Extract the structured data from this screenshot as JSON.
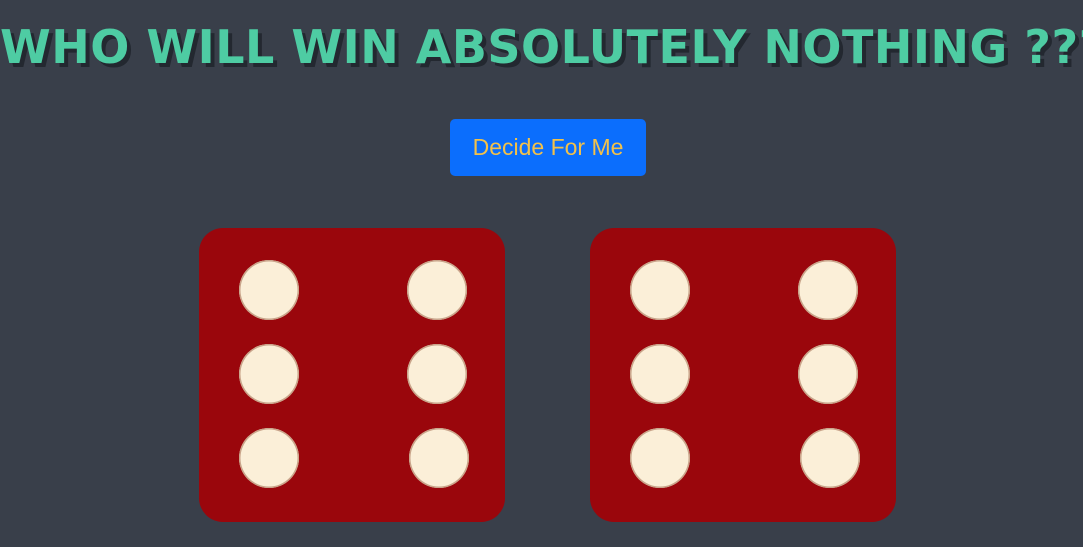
{
  "header": {
    "title": "WHO WILL WIN ABSOLUTELY NOTHING ???"
  },
  "controls": {
    "decide_label": "Decide For Me"
  },
  "dice": [
    {
      "name": "die-left",
      "value": 6,
      "color": "#9a060c",
      "pip_color": "#fbefd8"
    },
    {
      "name": "die-right",
      "value": 6,
      "color": "#9a060c",
      "pip_color": "#fbefd8"
    }
  ],
  "colors": {
    "background": "#393f4a",
    "title": "#4ecca3",
    "button_bg": "#0b6efd",
    "button_text": "#f2c14a"
  }
}
